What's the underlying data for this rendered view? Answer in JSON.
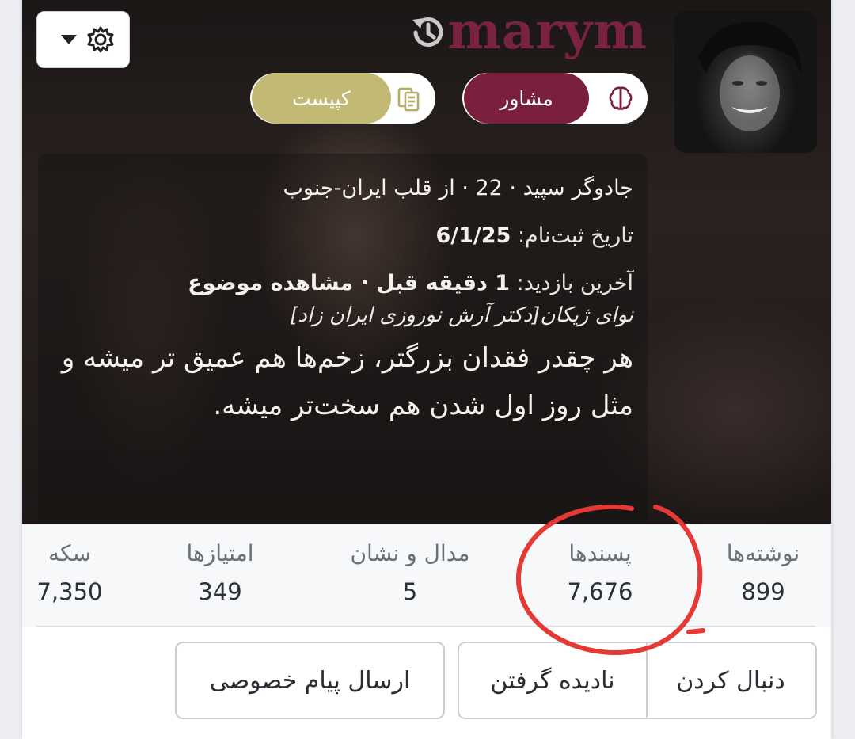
{
  "header": {
    "username": "marym",
    "role_label": "مشاور",
    "copy_label": "کپیست"
  },
  "profile": {
    "bio_line": "جادوگر سپید · 22 · از قلب ایران-جنوب",
    "registered_label": "تاریخ ثبت‌نام:",
    "registered_value": "6/1/25",
    "last_visit_label": "آخرین بازدید:",
    "last_visit_value": "1 دقیقه قبل · مشاهده موضوع",
    "last_topic": "نوای ژیکان[دکتر آرش نوروزی ایران زاد]",
    "quote": "هر چقدر فقدان بزرگتر، زخم‌ها هم عمیق تر میشه و مثل روز اول شدن هم سخت‌تر میشه."
  },
  "stats": [
    {
      "label": "نوشته‌ها",
      "value": "899"
    },
    {
      "label": "پسندها",
      "value": "7,676"
    },
    {
      "label": "مدال و نشان",
      "value": "5"
    },
    {
      "label": "امتیازها",
      "value": "349"
    },
    {
      "label": "سکه",
      "value": "7,350"
    }
  ],
  "actions": {
    "follow": "دنبال کردن",
    "ignore": "نادیده گرفتن",
    "message": "ارسال پیام خصوصی"
  },
  "colors": {
    "brand": "#7a2340",
    "role_pill": "#7a1f3d",
    "copy_pill": "#c2b975",
    "annotation": "#e53935"
  }
}
